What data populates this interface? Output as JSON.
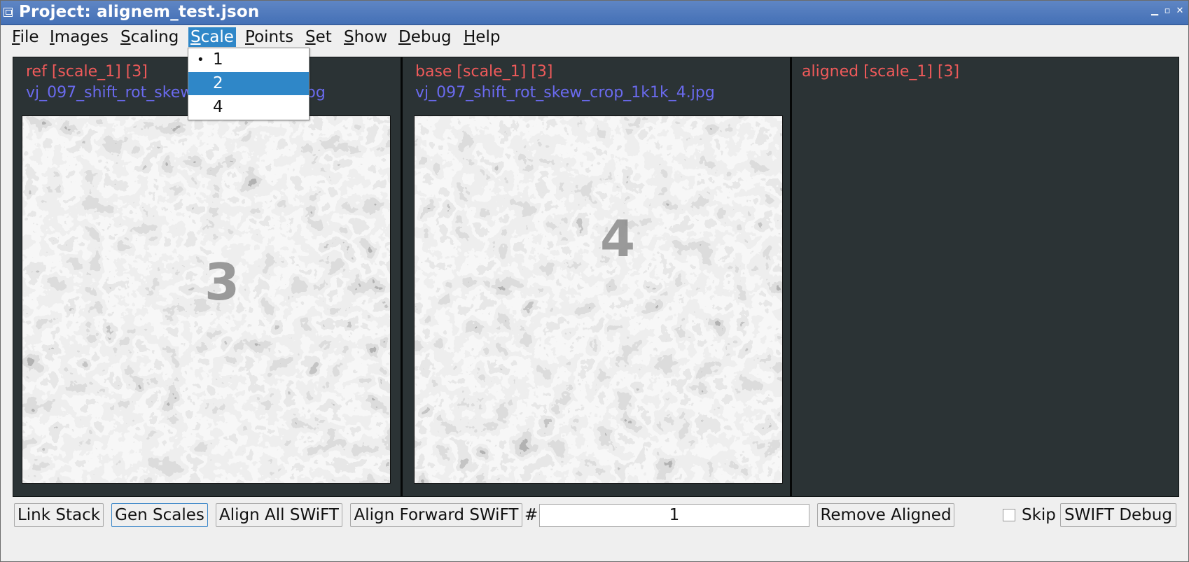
{
  "window": {
    "title": "Project: alignem_test.json"
  },
  "menubar": {
    "items": [
      {
        "label": "File",
        "key": "F",
        "rest": "ile"
      },
      {
        "label": "Images",
        "key": "I",
        "rest": "mages"
      },
      {
        "label": "Scaling",
        "key": "S",
        "rest": "caling"
      },
      {
        "label": "Scale",
        "key": "S",
        "rest": "cale"
      },
      {
        "label": "Points",
        "key": "P",
        "rest": "oints"
      },
      {
        "label": "Set",
        "key": "S",
        "rest": "et"
      },
      {
        "label": "Show",
        "key": "S",
        "rest": "how"
      },
      {
        "label": "Debug",
        "key": "D",
        "rest": "ebug"
      },
      {
        "label": "Help",
        "key": "H",
        "rest": "elp"
      }
    ],
    "active": "Scale"
  },
  "scale_menu": {
    "options": [
      "1",
      "2",
      "4"
    ],
    "checked": "1",
    "highlighted": "2",
    "bullet": "•"
  },
  "panels": {
    "ref": {
      "title": "ref [scale_1] [3]",
      "filename": "vj_097_shift_rot_skew_crop_1k1k_3.jpg",
      "overlay_number": "3"
    },
    "base": {
      "title": "base [scale_1] [3]",
      "filename": "vj_097_shift_rot_skew_crop_1k1k_4.jpg",
      "overlay_number": "4"
    },
    "aligned": {
      "title": "aligned [scale_1] [3]"
    }
  },
  "colors": {
    "titlebar": "#4a76bb",
    "panel_bg": "#2b3335",
    "title_red": "#ef5a5a",
    "file_blue": "#6a6aee",
    "highlight": "#2f87c8"
  },
  "controls": {
    "link_stack": "Link Stack",
    "gen_scales": "Gen Scales",
    "align_all": "Align All SWiFT",
    "align_forward": "Align Forward SWiFT",
    "hash": "#",
    "forward_count": "1",
    "remove_aligned": "Remove Aligned",
    "skip_label": "Skip",
    "skip_checked": false,
    "swift_debug": "SWIFT Debug"
  }
}
